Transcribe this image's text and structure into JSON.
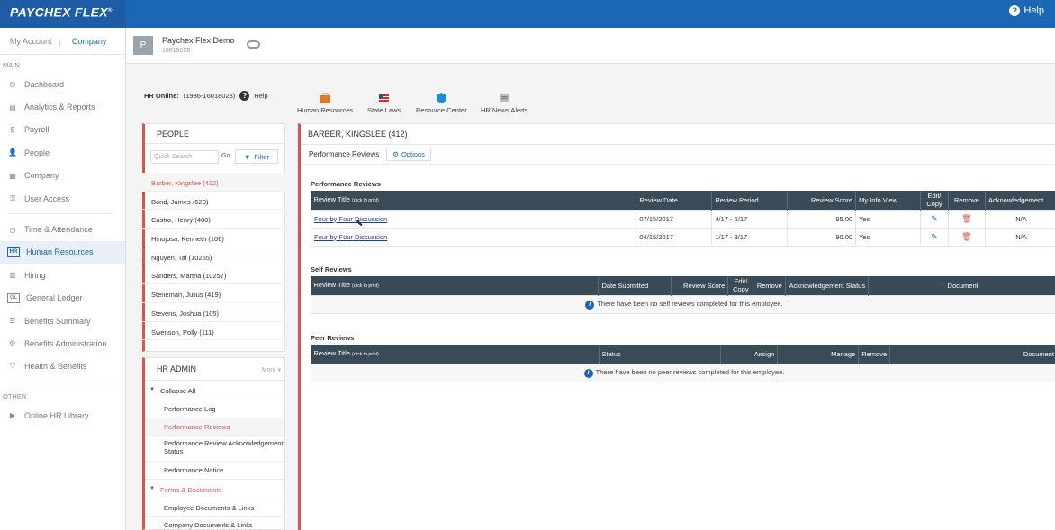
{
  "brand": {
    "name": "PAYCHEX FLEX",
    "trademark": "®"
  },
  "topbar": {
    "help_label": "Help"
  },
  "account_tabs": {
    "my_account": "My Account",
    "separator": "|",
    "company": "Company"
  },
  "sidebar": {
    "main_label": "MAIN",
    "items": [
      {
        "label": "Dashboard",
        "icon": "dashboard-icon"
      },
      {
        "label": "Analytics & Reports",
        "icon": "reports-icon"
      },
      {
        "label": "Payroll",
        "icon": "dollar-icon"
      },
      {
        "label": "People",
        "icon": "person-icon"
      },
      {
        "label": "Company",
        "icon": "building-icon"
      },
      {
        "label": "User Access",
        "icon": "user-access-icon"
      }
    ],
    "items2": [
      {
        "label": "Time & Attendance",
        "icon": "clock-icon"
      },
      {
        "label": "Human Resources",
        "icon": "hr-icon",
        "badge": "HR",
        "active": true
      },
      {
        "label": "Hiring",
        "icon": "hiring-icon"
      },
      {
        "label": "General Ledger",
        "icon": "gl-icon",
        "badge": "GL"
      },
      {
        "label": "Benefits Summary",
        "icon": "list-icon"
      },
      {
        "label": "Benefits Administration",
        "icon": "gear-icon"
      },
      {
        "label": "Health & Benefits",
        "icon": "shield-icon"
      }
    ],
    "other_label": "OTHER",
    "items3": [
      {
        "label": "Online HR Library",
        "icon": "play-icon"
      }
    ]
  },
  "company": {
    "avatar": "P",
    "name": "Paychex Flex Demo",
    "id": "16018028"
  },
  "hr_online": {
    "label": "HR Online:",
    "value": "(1986-16018028)",
    "help": "Help"
  },
  "toolbar": [
    {
      "label": "Human Resources",
      "color": "#e07b2a"
    },
    {
      "label": "State Laws",
      "color": "#c9302c"
    },
    {
      "label": "Resource Center",
      "color": "#1b8fd6"
    },
    {
      "label": "HR News Alerts",
      "color": "#999999"
    }
  ],
  "people": {
    "title": "PEOPLE",
    "search_placeholder": "Quick Search",
    "go": "Go",
    "filter": "Filter",
    "list": [
      "Barber, Kingslee (412)",
      "Bond, James (520)",
      "Castro, Henry (400)",
      "Hinojosa, Kenneth (106)",
      "Nguyen, Tai (10255)",
      "Sanders, Martha (10257)",
      "Steneman, Julius (419)",
      "Stevens, Joshua (105)",
      "Swenson, Polly (111)"
    ]
  },
  "hr_admin": {
    "title": "HR ADMIN",
    "more": "More",
    "collapse_all": "Collapse All",
    "items": [
      "Performance Log",
      "Performance Reviews",
      "Performance Review Acknowledgement Status",
      "Performance Notice"
    ],
    "forms_group": "Forms & Documents",
    "forms_items": [
      "Employee Documents & Links",
      "Company Documents & Links"
    ]
  },
  "employee": {
    "header": "BARBER, KINGSLEE (412)",
    "tab": "Performance Reviews",
    "options": "Options"
  },
  "perf_reviews": {
    "title": "Performance Reviews",
    "headers": {
      "title": "Review Title",
      "click_note": "(click to print)",
      "date": "Review Date",
      "period": "Review Period",
      "score": "Review Score",
      "info": "My Info View",
      "edit": "Edit/ Copy",
      "remove": "Remove",
      "ack": "Acknowledgement"
    },
    "rows": [
      {
        "title": "Four by Four Discussion",
        "date": "07/15/2017",
        "period": "4/17 - 6/17",
        "score": "95.00",
        "info": "Yes",
        "ack": "N/A"
      },
      {
        "title": "Four by Four Discussion",
        "date": "04/15/2017",
        "period": "1/17 - 3/17",
        "score": "90.00",
        "info": "Yes",
        "ack": "N/A"
      }
    ]
  },
  "self_reviews": {
    "title": "Self Reviews",
    "headers": {
      "title": "Review Title",
      "click_note": "(click to print)",
      "date": "Date Submitted",
      "score": "Review Score",
      "edit": "Edit/ Copy",
      "remove": "Remove",
      "ack": "Acknowledgement Status",
      "doc": "Document"
    },
    "empty": "There have been no self reviews completed for this employee."
  },
  "peer_reviews": {
    "title": "Peer Reviews",
    "headers": {
      "title": "Review Title",
      "click_note": "(click to print)",
      "status": "Status",
      "assign": "Assign",
      "manage": "Manage",
      "remove": "Remove",
      "doc": "Document"
    },
    "empty": "There have been no peer reviews completed for this employee."
  }
}
